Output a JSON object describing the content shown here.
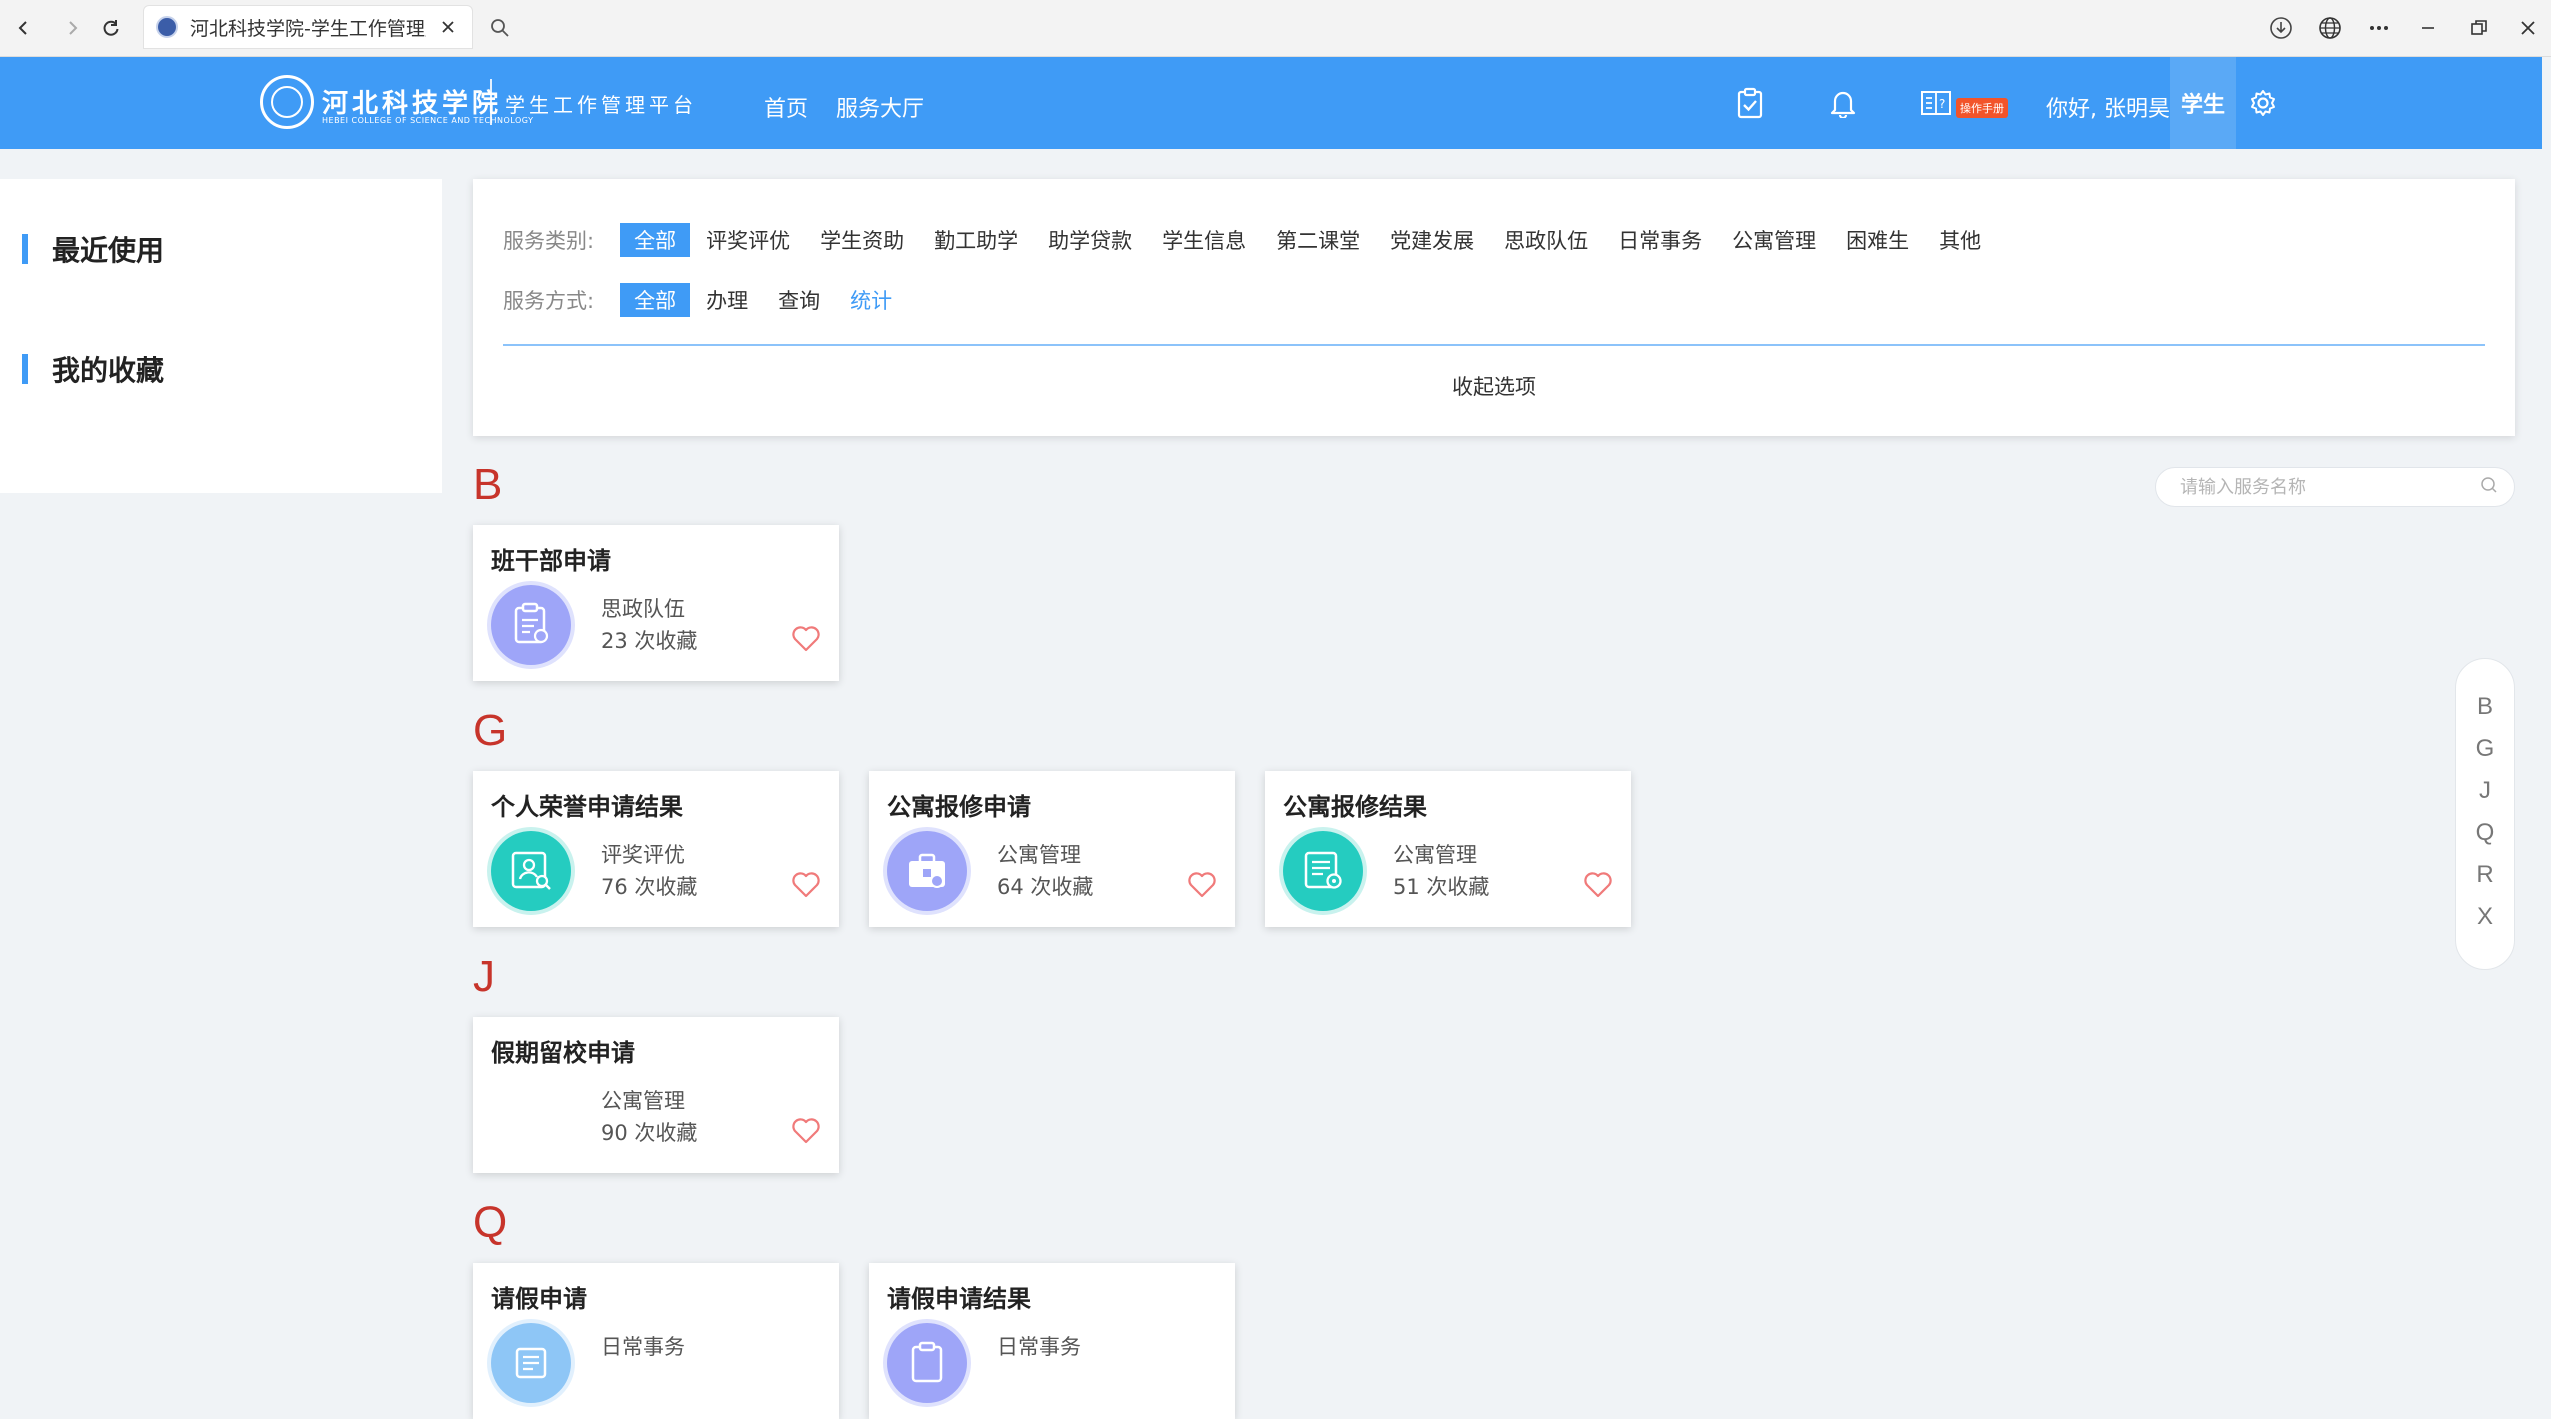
{
  "browser": {
    "tab_title": "河北科技学院-学生工作管理服",
    "icons": [
      "back-icon",
      "forward-icon",
      "reload-icon",
      "close-icon",
      "search-icon",
      "download-icon",
      "globe-icon",
      "more-icon",
      "minimize-icon",
      "restore-icon",
      "window-close-icon"
    ]
  },
  "header": {
    "school_name": "河北科技学院",
    "school_name_en": "HEBEI COLLEGE OF SCIENCE AND TECHNOLOGY",
    "platform_name": "学生工作管理平台",
    "nav": [
      "首页",
      "服务大厅"
    ],
    "manual_badge": "操作手册",
    "greeting": "你好, 张明昊",
    "role": "学生",
    "accent_color": "#3f9bf6"
  },
  "sidebar": {
    "items": [
      "最近使用",
      "我的收藏"
    ]
  },
  "filters": {
    "category_label": "服务类别:",
    "categories": [
      "全部",
      "评奖评优",
      "学生资助",
      "勤工助学",
      "助学贷款",
      "学生信息",
      "第二课堂",
      "党建发展",
      "思政队伍",
      "日常事务",
      "公寓管理",
      "困难生",
      "其他"
    ],
    "category_selected": "全部",
    "method_label": "服务方式:",
    "methods": [
      "全部",
      "办理",
      "查询",
      "统计"
    ],
    "method_selected": "全部",
    "collapse_label": "收起选项"
  },
  "search": {
    "placeholder": "请输入服务名称"
  },
  "sections": [
    {
      "letter": "B",
      "cards": [
        {
          "title": "班干部申请",
          "category": "思政队伍",
          "favorites": "23 次收藏",
          "icon": "clipboard-icon"
        }
      ]
    },
    {
      "letter": "G",
      "cards": [
        {
          "title": "个人荣誉申请结果",
          "category": "评奖评优",
          "favorites": "76 次收藏",
          "icon": "profile-search-icon"
        },
        {
          "title": "公寓报修申请",
          "category": "公寓管理",
          "favorites": "64 次收藏",
          "icon": "toolbox-icon"
        },
        {
          "title": "公寓报修结果",
          "category": "公寓管理",
          "favorites": "51 次收藏",
          "icon": "document-settings-icon"
        }
      ]
    },
    {
      "letter": "J",
      "cards": [
        {
          "title": "假期留校申请",
          "category": "公寓管理",
          "favorites": "90 次收藏",
          "icon": ""
        }
      ]
    },
    {
      "letter": "Q",
      "cards": [
        {
          "title": "请假申请",
          "category": "日常事务",
          "favorites": "",
          "icon": "form-icon"
        },
        {
          "title": "请假申请结果",
          "category": "日常事务",
          "favorites": "",
          "icon": "clipboard-icon"
        }
      ]
    }
  ],
  "letter_index": [
    "B",
    "G",
    "J",
    "Q",
    "R",
    "X"
  ],
  "colors": {
    "letter_heading": "#c7342b",
    "heart": "#f07a7a",
    "icon_purple": "#9ea5f8",
    "icon_teal": "#25ccc0",
    "icon_lightblue": "#8ec6f6"
  }
}
